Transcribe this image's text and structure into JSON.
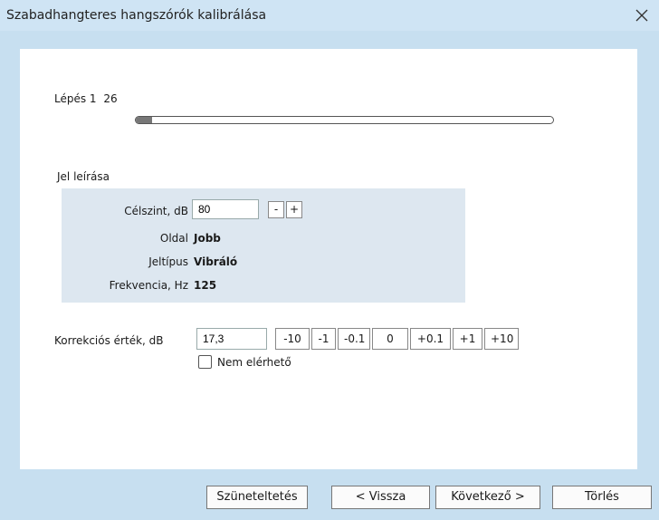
{
  "window": {
    "title": "Szabadhangteres hangszórók kalibrálása"
  },
  "step": {
    "label": "Lépés 1",
    "total": "26",
    "progress_fraction": 0.04
  },
  "signal": {
    "section_label": "Jel leírása",
    "target_label": "Célszint, dB",
    "target_value": "80",
    "minus": "-",
    "plus": "+",
    "side_label": "Oldal",
    "side_value": "Jobb",
    "type_label": "Jeltípus",
    "type_value": "Vibráló",
    "freq_label": "Frekvencia, Hz",
    "freq_value": "125"
  },
  "correction": {
    "label": "Korrekciós érték, dB",
    "value": "17,3",
    "buttons": [
      "-10",
      "-1",
      "-0.1",
      "0",
      "+0.1",
      "+1",
      "+10"
    ],
    "unavailable_label": "Nem elérhető",
    "unavailable_checked": false
  },
  "footer": {
    "pause": "Szüneteltetés",
    "back": "< Vissza",
    "next": "Következő >",
    "delete": "Törlés"
  }
}
